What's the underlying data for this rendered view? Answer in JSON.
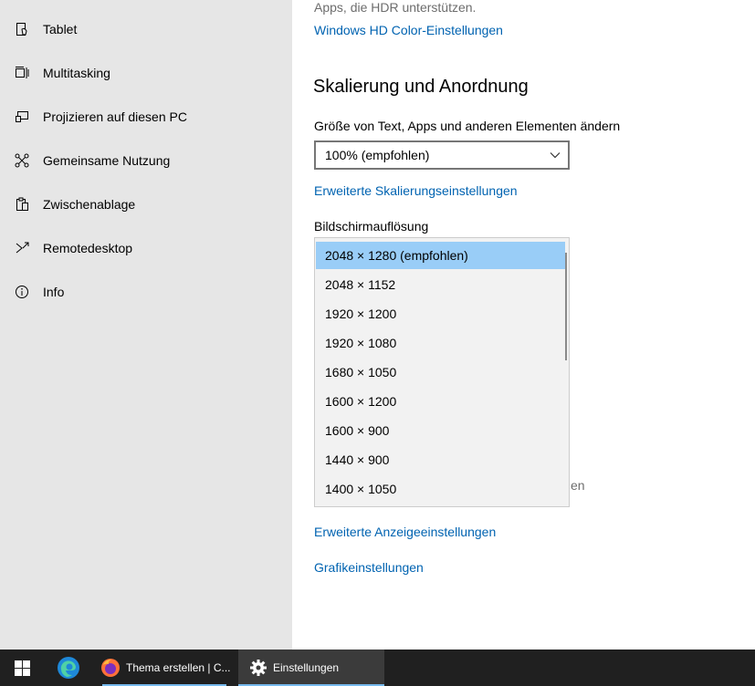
{
  "sidebar": {
    "items": [
      {
        "label": "Tablet",
        "icon": "tablet-icon"
      },
      {
        "label": "Multitasking",
        "icon": "multitasking-icon"
      },
      {
        "label": "Projizieren auf diesen PC",
        "icon": "project-icon"
      },
      {
        "label": "Gemeinsame Nutzung",
        "icon": "share-icon"
      },
      {
        "label": "Zwischenablage",
        "icon": "clipboard-icon"
      },
      {
        "label": "Remotedesktop",
        "icon": "remote-desktop-icon"
      },
      {
        "label": "Info",
        "icon": "info-icon"
      }
    ]
  },
  "main": {
    "hdr_text": "Apps, die HDR unterstützen.",
    "hdr_link": "Windows HD Color-Einstellungen",
    "section_title": "Skalierung und Anordnung",
    "scale_label": "Größe von Text, Apps und anderen Elementen ändern",
    "scale_value": "100% (empfohlen)",
    "advanced_scaling_link": "Erweiterte Skalierungseinstellungen",
    "resolution_label": "Bildschirmauflösung",
    "resolution_options": [
      "2048 × 1280 (empfohlen)",
      "2048 × 1152",
      "1920 × 1200",
      "1920 × 1080",
      "1680 × 1050",
      "1600 × 1200",
      "1600 × 900",
      "1440 × 900",
      "1400 × 1050"
    ],
    "selected_resolution": "2048 × 1280 (empfohlen)",
    "partial_text": "en",
    "advanced_display_link": "Erweiterte Anzeigeeinstellungen",
    "graphics_link": "Grafikeinstellungen"
  },
  "taskbar": {
    "firefox_label": "Thema erstellen | C...",
    "settings_label": "Einstellungen",
    "accent": "#76b9ed"
  }
}
